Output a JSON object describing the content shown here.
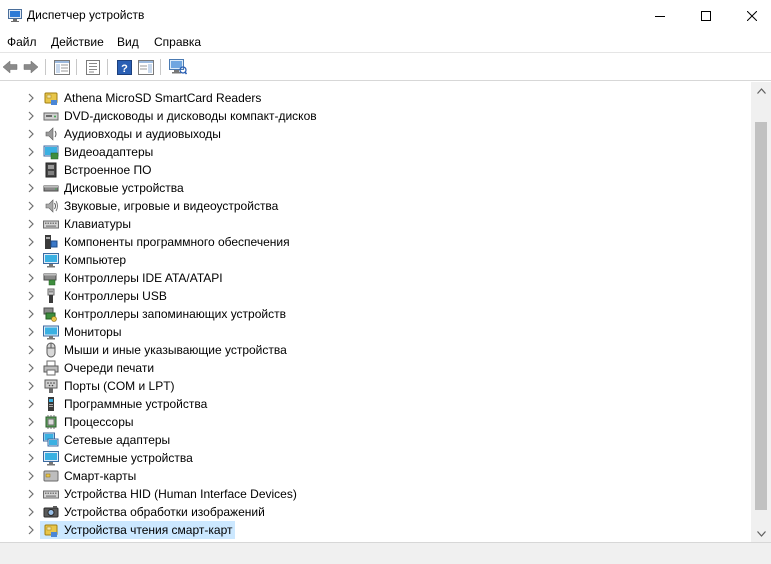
{
  "window": {
    "title": "Диспетчер устройств",
    "icon": "device-manager-icon"
  },
  "menu": [
    "Файл",
    "Действие",
    "Вид",
    "Справка"
  ],
  "toolbar": [
    "back-arrow-icon",
    "forward-arrow-icon",
    "show-hide-console-tree-icon",
    "properties-icon",
    "help-icon",
    "action-pane-icon",
    "scan-hardware-icon"
  ],
  "tree": {
    "items": [
      {
        "label": "Athena MicroSD SmartCard Readers",
        "icon": "smartcard-reader-icon",
        "selected": false
      },
      {
        "label": "DVD-дисководы и дисководы компакт-дисков",
        "icon": "dvd-drive-icon",
        "selected": false
      },
      {
        "label": "Аудиовходы и аудиовыходы",
        "icon": "audio-icon",
        "selected": false
      },
      {
        "label": "Видеоадаптеры",
        "icon": "display-adapter-icon",
        "selected": false
      },
      {
        "label": "Встроенное ПО",
        "icon": "firmware-icon",
        "selected": false
      },
      {
        "label": "Дисковые устройства",
        "icon": "disk-drive-icon",
        "selected": false
      },
      {
        "label": "Звуковые, игровые и видеоустройства",
        "icon": "sound-icon",
        "selected": false
      },
      {
        "label": "Клавиатуры",
        "icon": "keyboard-icon",
        "selected": false
      },
      {
        "label": "Компоненты программного обеспечения",
        "icon": "software-component-icon",
        "selected": false
      },
      {
        "label": "Компьютер",
        "icon": "computer-icon",
        "selected": false
      },
      {
        "label": "Контроллеры IDE ATA/ATAPI",
        "icon": "ide-controller-icon",
        "selected": false
      },
      {
        "label": "Контроллеры USB",
        "icon": "usb-icon",
        "selected": false
      },
      {
        "label": "Контроллеры запоминающих устройств",
        "icon": "storage-controller-icon",
        "selected": false
      },
      {
        "label": "Мониторы",
        "icon": "monitor-icon",
        "selected": false
      },
      {
        "label": "Мыши и иные указывающие устройства",
        "icon": "mouse-icon",
        "selected": false
      },
      {
        "label": "Очереди печати",
        "icon": "print-queue-icon",
        "selected": false
      },
      {
        "label": "Порты (COM и LPT)",
        "icon": "port-icon",
        "selected": false
      },
      {
        "label": "Программные устройства",
        "icon": "software-device-icon",
        "selected": false
      },
      {
        "label": "Процессоры",
        "icon": "processor-icon",
        "selected": false
      },
      {
        "label": "Сетевые адаптеры",
        "icon": "network-adapter-icon",
        "selected": false
      },
      {
        "label": "Системные устройства",
        "icon": "system-device-icon",
        "selected": false
      },
      {
        "label": "Смарт-карты",
        "icon": "smartcard-icon",
        "selected": false
      },
      {
        "label": "Устройства HID (Human Interface Devices)",
        "icon": "hid-icon",
        "selected": false
      },
      {
        "label": "Устройства обработки изображений",
        "icon": "imaging-device-icon",
        "selected": false
      },
      {
        "label": "Устройства чтения смарт-карт",
        "icon": "smartcard-reader-icon",
        "selected": true
      }
    ]
  },
  "colors": {
    "selection": "#cce8ff",
    "chrome": "#f0f0f0",
    "accent": "#1a6fc2"
  }
}
